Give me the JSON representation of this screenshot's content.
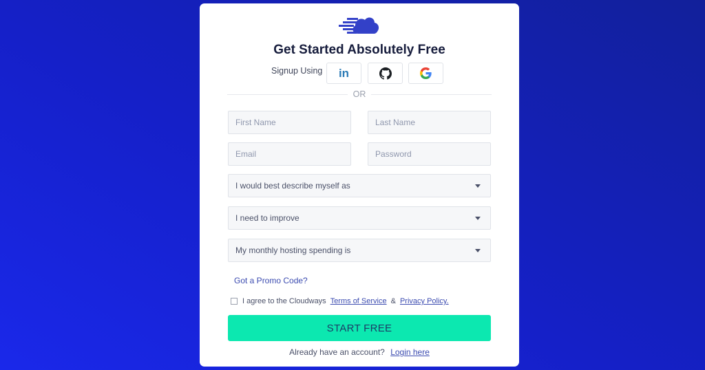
{
  "header": {
    "title": "Get Started Absolutely Free",
    "signup_using": "Signup Using",
    "social": [
      {
        "name": "linkedin",
        "icon": "linkedin-icon"
      },
      {
        "name": "github",
        "icon": "github-icon"
      },
      {
        "name": "google",
        "icon": "google-icon"
      }
    ],
    "or": "OR"
  },
  "form": {
    "first_name_placeholder": "First Name",
    "last_name_placeholder": "Last Name",
    "email_placeholder": "Email",
    "password_placeholder": "Password",
    "selects": [
      {
        "label": "I would best describe myself as"
      },
      {
        "label": "I need to improve"
      },
      {
        "label": "My monthly hosting spending is"
      }
    ],
    "promo": "Got a Promo Code?",
    "agree_text": "I agree to the Cloudways",
    "terms": "Terms of Service",
    "amp": "&",
    "privacy": "Privacy Policy.",
    "submit": "START FREE",
    "have_account": "Already have an account?",
    "login": "Login here"
  },
  "colors": {
    "brand": "#3341c8",
    "cta": "#0ce8b0",
    "background": "#1520c8"
  }
}
